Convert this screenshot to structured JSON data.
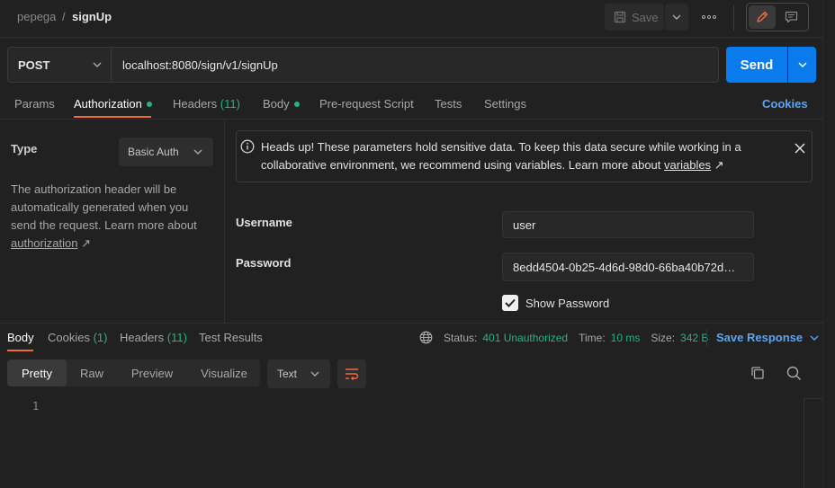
{
  "breadcrumb": {
    "workspace": "pepega",
    "separator": "/",
    "request": "signUp"
  },
  "toolbar": {
    "save_label": "Save"
  },
  "request": {
    "method": "POST",
    "url": "localhost:8080/sign/v1/signUp",
    "send_label": "Send"
  },
  "request_tabs": {
    "params": "Params",
    "authorization": "Authorization",
    "headers": "Headers",
    "headers_count": "(11)",
    "body": "Body",
    "prerequest": "Pre-request Script",
    "tests": "Tests",
    "settings": "Settings",
    "cookies": "Cookies"
  },
  "auth": {
    "type_label": "Type",
    "type_value": "Basic Auth",
    "desc": "The authorization header will be automatically generated when you send the request. Learn more about",
    "desc_link": "authorization",
    "link_arrow": "↗",
    "alert_text": "Heads up! These parameters hold sensitive data. To keep this data secure while working in a collaborative environment, we recommend using variables. Learn more about",
    "alert_link": "variables",
    "username_label": "Username",
    "username_value": "user",
    "password_label": "Password",
    "password_value": "8edd4504-0b25-4d6d-98d0-66ba40b72d…",
    "show_password_label": "Show Password"
  },
  "response": {
    "tabs": {
      "body": "Body",
      "cookies": "Cookies",
      "cookies_count": "(1)",
      "headers": "Headers",
      "headers_count": "(11)",
      "test_results": "Test Results"
    },
    "status_label": "Status:",
    "status_value": "401 Unauthorized",
    "time_label": "Time:",
    "time_value": "10 ms",
    "size_label": "Size:",
    "size_value": "342 B",
    "save_response": "Save Response",
    "views": {
      "pretty": "Pretty",
      "raw": "Raw",
      "preview": "Preview",
      "visualize": "Visualize"
    },
    "format": "Text",
    "line_number": "1"
  },
  "colors": {
    "accent_orange": "#f26b3a",
    "send_blue": "#097bed",
    "success_green": "#26b47f",
    "link_blue": "#5aa5f5"
  }
}
